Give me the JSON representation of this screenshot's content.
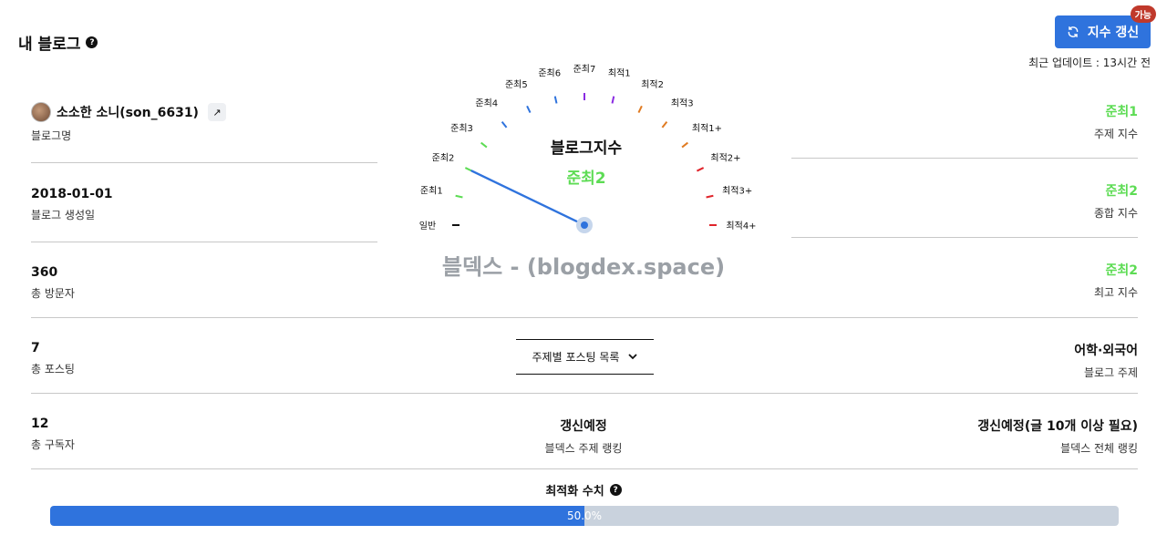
{
  "header": {
    "title": "내 블로그",
    "help": "?",
    "refresh_label": "지수 갱신",
    "refresh_badge": "가능",
    "updated": "최근 업데이트 : 13시간 전"
  },
  "profile": {
    "name": "소소한 소니(son_6631)",
    "label": "블로그명"
  },
  "left_stats": [
    {
      "value": "2018-01-01",
      "label": "블로그 생성일"
    },
    {
      "value": "360",
      "label": "총 방문자"
    },
    {
      "value": "7",
      "label": "총 포스팅"
    },
    {
      "value": "12",
      "label": "총 구독자"
    }
  ],
  "right_stats": [
    {
      "value": "준최1",
      "label": "주제 지수"
    },
    {
      "value": "준최2",
      "label": "종합 지수"
    },
    {
      "value": "준최2",
      "label": "최고 지수"
    },
    {
      "value": "어학·외국어",
      "label": "블로그 주제"
    },
    {
      "value": "갱신예정(글 10개 이상 필요)",
      "label": "블덱스 전체 랭킹"
    }
  ],
  "center": {
    "rank_value": "갱신예정",
    "rank_label": "블덱스 주제 랭킹",
    "dropdown_label": "주제별 포스팅 목록",
    "watermark": "블덱스 - (blogdex.space)"
  },
  "gauge": {
    "title": "블로그지수",
    "current": "준최2",
    "needle_level": 2,
    "levels": [
      {
        "label": "일반",
        "color": "#111111"
      },
      {
        "label": "준최1",
        "color": "#5ddc54"
      },
      {
        "label": "준최2",
        "color": "#5ddc54"
      },
      {
        "label": "준최3",
        "color": "#5ddc54"
      },
      {
        "label": "준최4",
        "color": "#2f73dd"
      },
      {
        "label": "준최5",
        "color": "#2f73dd"
      },
      {
        "label": "준최6",
        "color": "#2f73dd"
      },
      {
        "label": "준최7",
        "color": "#8a2be2"
      },
      {
        "label": "최적1",
        "color": "#8a2be2"
      },
      {
        "label": "최적2",
        "color": "#e07b22"
      },
      {
        "label": "최적3",
        "color": "#e07b22"
      },
      {
        "label": "최적1+",
        "color": "#e07b22"
      },
      {
        "label": "최적2+",
        "color": "#e0242b"
      },
      {
        "label": "최적3+",
        "color": "#e0242b"
      },
      {
        "label": "최적4+",
        "color": "#e0242b"
      }
    ]
  },
  "optimization": {
    "title": "최적화 수치",
    "percent_text": "50.0%",
    "fraction": 0.5
  }
}
